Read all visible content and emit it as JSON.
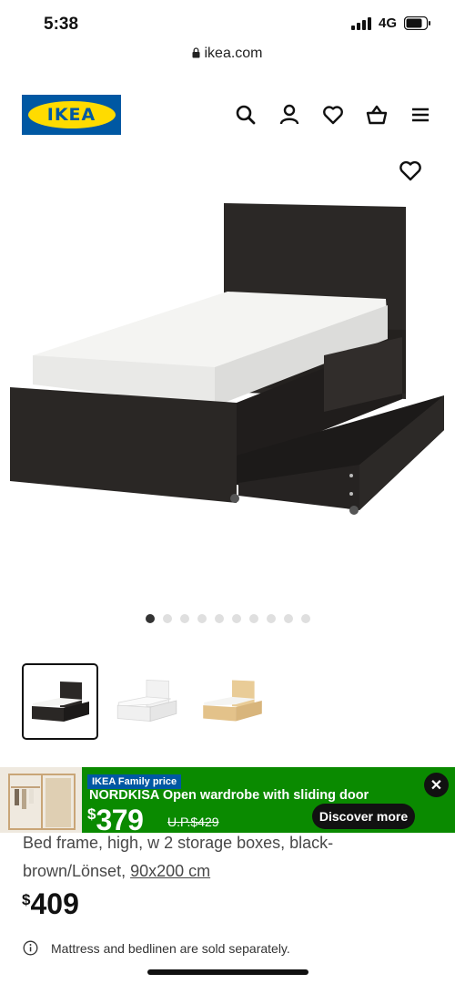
{
  "status_bar": {
    "time": "5:38",
    "network": "4G"
  },
  "browser": {
    "url": "ikea.com"
  },
  "header": {
    "logo_text": "IKEA"
  },
  "product": {
    "description_prefix": "Bed frame, high, w 2 storage boxes, black-brown/Lönset, ",
    "size_link": "90x200 cm",
    "currency": "$",
    "price": "409",
    "note": "Mattress and bedlinen are sold separately.",
    "gallery": {
      "image_count": 10,
      "active_index": 0
    },
    "variants": [
      "black-brown",
      "white",
      "white stained oak veneer"
    ]
  },
  "promo": {
    "tag": "IKEA Family price",
    "title": "NORDKISA Open wardrobe with sliding door",
    "currency": "$",
    "price": "379",
    "old_price": "U.P.$429",
    "button": "Discover more"
  },
  "colors": {
    "ikea_blue": "#0058a3",
    "ikea_yellow": "#ffdb00",
    "promo_green": "#0a8a00"
  }
}
